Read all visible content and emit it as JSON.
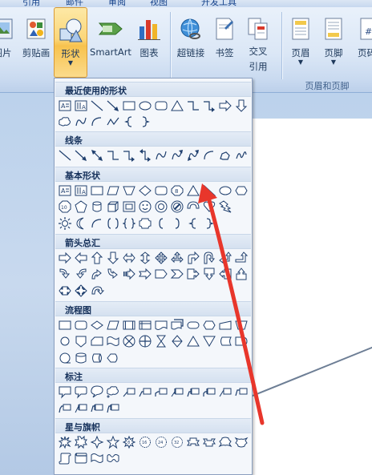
{
  "tabs": [
    "引用",
    "邮件",
    "审阅",
    "视图",
    "开发工具"
  ],
  "ribbon": {
    "picture_label": "图片",
    "clipart_label": "剪贴画",
    "shapes_label": "形状",
    "smartart_label": "SmartArt",
    "chart_label": "图表",
    "hyperlink_label": "超链接",
    "bookmark_label": "书签",
    "crossref_label_1": "交叉",
    "crossref_label_2": "引用",
    "header_label": "页眉",
    "footer_label": "页脚",
    "pagenum_label": "页码",
    "group_header_footer": "页眉和页脚"
  },
  "shapes_menu": {
    "categories": [
      {
        "label": "最近使用的形状",
        "rows": [
          [
            "textbox",
            "vtextbox",
            "line",
            "arrow-line",
            "rect",
            "oval",
            "rounded-rect",
            "triangle",
            "elbow",
            "elbow-arrow",
            "right-arrow",
            "down-arrow"
          ],
          [
            "callout-cloud",
            "curve",
            "arc",
            "wave-line",
            "left-brace",
            "right-brace"
          ]
        ]
      },
      {
        "label": "线条",
        "rows": [
          [
            "line",
            "arrow-line",
            "double-arrow-line",
            "elbow",
            "elbow-arrow",
            "elbow-double-arrow",
            "curve",
            "curve-arrow",
            "curve-double-arrow",
            "arc",
            "freeform",
            "scribble"
          ]
        ]
      },
      {
        "label": "基本形状",
        "rows": [
          [
            "textbox",
            "vtextbox",
            "rect",
            "parallelogram",
            "trapezoid",
            "diamond",
            "rounded-rect",
            "octagon",
            "triangle",
            "right-triangle",
            "oval",
            "hexagon"
          ],
          [
            "decagon",
            "pentagon",
            "can",
            "cube",
            "bevel",
            "smiley",
            "donut",
            "no-symbol",
            "block-arc",
            "heart",
            "lightning"
          ],
          [
            "sun",
            "moon",
            "arc",
            "bracket-pair",
            "brace-pair",
            "plaque",
            "left-bracket",
            "right-bracket",
            "left-brace",
            "right-brace"
          ]
        ]
      },
      {
        "label": "箭头总汇",
        "rows": [
          [
            "right-arrow",
            "left-arrow",
            "up-arrow",
            "down-arrow",
            "left-right-arrow",
            "up-down-arrow",
            "quad-arrow",
            "left-right-up-arrow",
            "bent-arrow",
            "u-turn-arrow",
            "left-up-arrow",
            "bent-up-arrow"
          ],
          [
            "curved-right-arrow",
            "curved-left-arrow",
            "curved-up-arrow",
            "curved-down-arrow",
            "striped-right-arrow",
            "notched-right-arrow",
            "pentagon-arrow",
            "chevron",
            "right-arrow-callout",
            "down-arrow-callout",
            "left-arrow-callout",
            "up-arrow-callout"
          ],
          [
            "left-right-arrow-callout",
            "quad-arrow-callout",
            "circular-arrow"
          ]
        ]
      },
      {
        "label": "流程图",
        "rows": [
          [
            "process",
            "alternate-process",
            "decision",
            "data",
            "predefined-process",
            "internal-storage",
            "document",
            "multidocument",
            "terminator",
            "preparation",
            "manual-input",
            "manual-operation"
          ],
          [
            "connector",
            "offpage-connector",
            "card",
            "punched-tape",
            "summing-junction",
            "or",
            "collate",
            "sort",
            "extract",
            "merge",
            "stored-data",
            "delay"
          ],
          [
            "sequential-storage",
            "magnetic-disk",
            "direct-access-storage",
            "display"
          ]
        ]
      },
      {
        "label": "标注",
        "rows": [
          [
            "rect-callout",
            "rounded-callout",
            "oval-callout",
            "cloud-callout",
            "line-callout-1",
            "line-callout-2",
            "line-callout-3",
            "line-callout-1b",
            "line-callout-2b",
            "line-callout-3b",
            "line-callout-1c",
            "line-callout-2c"
          ],
          [
            "line-callout-3c",
            "line-callout-1d",
            "line-callout-2d",
            "line-callout-3d"
          ]
        ]
      },
      {
        "label": "星与旗帜",
        "rows": [
          [
            "explosion-1",
            "explosion-2",
            "star-4",
            "star-5",
            "star-8",
            "star-16",
            "star-24",
            "star-32",
            "up-ribbon",
            "down-ribbon",
            "curved-up-ribbon",
            "curved-down-ribbon"
          ],
          [
            "vertical-scroll",
            "horizontal-scroll",
            "wave",
            "double-wave"
          ]
        ]
      }
    ]
  },
  "colors": {
    "ribbon_text": "#1e395b",
    "shape_stroke": "#1f3f6e",
    "annotation_arrow": "#e8362b"
  }
}
